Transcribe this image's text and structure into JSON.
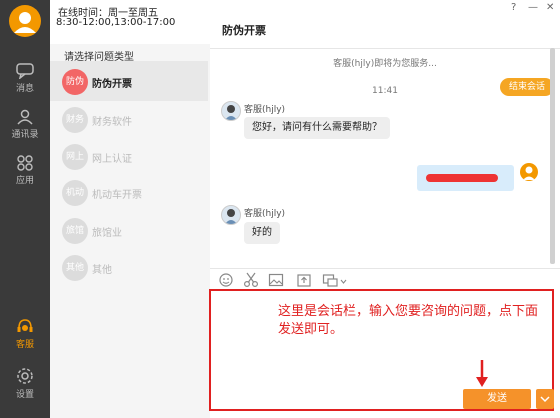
{
  "header": {
    "online_label": "在线时间：周一至周五",
    "online_hours": "8:30-12:00,13:00-17:00",
    "window_controls": {
      "help": "?",
      "minimize": "—",
      "close": "✕"
    }
  },
  "sidebar": {
    "items": [
      {
        "label": "消息",
        "icon": "chat-bubble-icon"
      },
      {
        "label": "通讯录",
        "icon": "contacts-icon"
      },
      {
        "label": "应用",
        "icon": "apps-icon"
      },
      {
        "label": "客服",
        "icon": "customer-service-icon"
      },
      {
        "label": "设置",
        "icon": "gear-icon"
      }
    ],
    "active_color": "#f39800"
  },
  "categories": {
    "heading": "请选择问题类型",
    "items": [
      {
        "badge": "防伪",
        "label": "防伪开票",
        "active": true
      },
      {
        "badge": "财务",
        "label": "财务软件"
      },
      {
        "badge": "网上",
        "label": "网上认证"
      },
      {
        "badge": "机动",
        "label": "机动车开票"
      },
      {
        "badge": "旅馆",
        "label": "旅馆业"
      },
      {
        "badge": "其他",
        "label": "其他"
      }
    ]
  },
  "chat": {
    "title": "防伪开票",
    "system_notice": "客服(hjly)即将为您服务...",
    "timestamp": "11:41",
    "end_button": "结束会话",
    "messages": [
      {
        "sender": "客服(hjly)",
        "text": "您好，请问有什么需要帮助？"
      },
      {
        "sender": "客服(hjly)",
        "text": "好的"
      }
    ]
  },
  "toolbar": {
    "icons": [
      "emoji-icon",
      "scissors-icon",
      "image-icon",
      "upload-icon",
      "screenshot-icon"
    ]
  },
  "input": {
    "annotation": "这里是会话栏，输入您要咨询的问题，点下面发送即可。",
    "send_label": "发送",
    "dropdown": "﹀"
  },
  "colors": {
    "accent": "#f39800",
    "annotation": "#e02020",
    "badge_active": "#f26666"
  }
}
